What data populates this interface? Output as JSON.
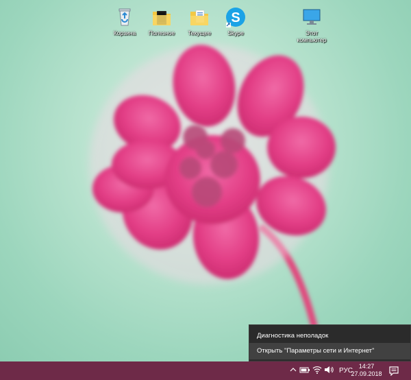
{
  "desktop": {
    "icons": [
      {
        "label": "Корзина",
        "icon": "recycle-bin-icon"
      },
      {
        "label": "Полезное",
        "icon": "folder-icon"
      },
      {
        "label": "Текущее",
        "icon": "folder-icon"
      },
      {
        "label": "Skype",
        "icon": "skype-icon"
      },
      {
        "label": "Этот компьютер",
        "icon": "computer-icon"
      }
    ]
  },
  "context_menu": {
    "items": [
      {
        "label": "Диагностика неполадок"
      },
      {
        "label": "Открыть \"Параметры сети и Интернет\""
      }
    ]
  },
  "taskbar": {
    "language": "РУС",
    "time": "14:27",
    "date": "27.09.2018",
    "color": "#6e2a48"
  }
}
